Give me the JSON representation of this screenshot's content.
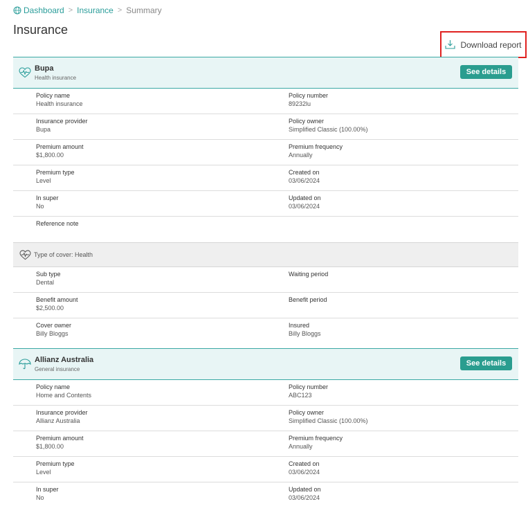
{
  "breadcrumb": {
    "home": "Dashboard",
    "section": "Insurance",
    "current": "Summary"
  },
  "page_title": "Insurance",
  "download_label": "Download report",
  "policies": [
    {
      "name": "Bupa",
      "category": "Health insurance",
      "details_label": "See details",
      "rows": [
        {
          "l_label": "Policy name",
          "l_value": "Health insurance",
          "r_label": "Policy number",
          "r_value": "89232lu"
        },
        {
          "l_label": "Insurance provider",
          "l_value": "Bupa",
          "r_label": "Policy owner",
          "r_value": "Simplified Classic (100.00%)"
        },
        {
          "l_label": "Premium amount",
          "l_value": "$1,800.00",
          "r_label": "Premium frequency",
          "r_value": "Annually"
        },
        {
          "l_label": "Premium type",
          "l_value": "Level",
          "r_label": "Created on",
          "r_value": "03/06/2024"
        },
        {
          "l_label": "In super",
          "l_value": "No",
          "r_label": "Updated on",
          "r_value": "03/06/2024"
        },
        {
          "l_label": "Reference note",
          "l_value": "",
          "r_label": "",
          "r_value": ""
        }
      ],
      "cover": {
        "title": "Type of cover: Health",
        "rows": [
          {
            "l_label": "Sub type",
            "l_value": "Dental",
            "r_label": "Waiting period",
            "r_value": ""
          },
          {
            "l_label": "Benefit amount",
            "l_value": "$2,500.00",
            "r_label": "Benefit period",
            "r_value": ""
          },
          {
            "l_label": "Cover owner",
            "l_value": "Billy Bloggs",
            "r_label": "Insured",
            "r_value": "Billy Bloggs"
          }
        ]
      }
    },
    {
      "name": "Allianz Australia",
      "category": "General insurance",
      "details_label": "See details",
      "rows": [
        {
          "l_label": "Policy name",
          "l_value": "Home and Contents",
          "r_label": "Policy number",
          "r_value": "ABC123"
        },
        {
          "l_label": "Insurance provider",
          "l_value": "Allianz Australia",
          "r_label": "Policy owner",
          "r_value": "Simplified Classic (100.00%)"
        },
        {
          "l_label": "Premium amount",
          "l_value": "$1,800.00",
          "r_label": "Premium frequency",
          "r_value": "Annually"
        },
        {
          "l_label": "Premium type",
          "l_value": "Level",
          "r_label": "Created on",
          "r_value": "03/06/2024"
        },
        {
          "l_label": "In super",
          "l_value": "No",
          "r_label": "Updated on",
          "r_value": "03/06/2024"
        }
      ]
    }
  ],
  "icons": {
    "breadcrumb": "globe-icon",
    "download": "download-tray-icon",
    "health": "heartbeat-icon",
    "general": "umbrella-icon"
  },
  "colors": {
    "accent": "#2a9d8f",
    "header_bg": "#e8f5f5",
    "highlight": "#e0201f"
  }
}
